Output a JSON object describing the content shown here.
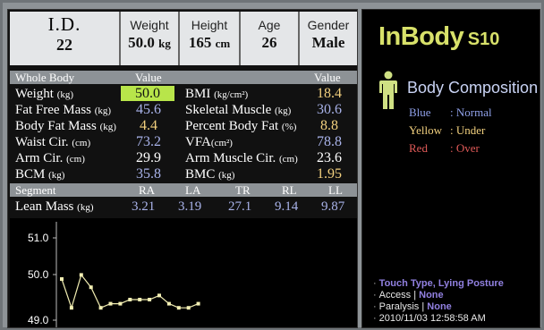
{
  "header": {
    "id_label": "I.D.",
    "id_value": "22",
    "weight_label": "Weight",
    "weight_value": "50.0",
    "weight_unit": "kg",
    "height_label": "Height",
    "height_value": "165",
    "height_unit": "cm",
    "age_label": "Age",
    "age_value": "26",
    "gender_label": "Gender",
    "gender_value": "Male"
  },
  "band": {
    "whole_body": "Whole Body",
    "value_1": "Value",
    "value_2": "Value",
    "segment": "Segment",
    "ra": "RA",
    "la": "LA",
    "tr": "TR",
    "rl": "RL",
    "ll": "LL"
  },
  "metrics": [
    {
      "label": "Weight",
      "unit": "(kg)",
      "value": "50.0",
      "right_label": "BMI",
      "right_unit": "(kg/cm²)",
      "right_value": "18.4"
    },
    {
      "label": "Fat Free Mass",
      "unit": "(kg)",
      "value": "45.6",
      "right_label": "Skeletal Muscle",
      "right_unit": "(kg)",
      "right_value": "30.6"
    },
    {
      "label": "Body Fat Mass",
      "unit": "(kg)",
      "value": "4.4",
      "right_label": "Percent Body Fat",
      "right_unit": "(%)",
      "right_value": "8.8"
    },
    {
      "label": "Waist Cir.",
      "unit": "(cm)",
      "value": "73.2",
      "right_label": "VFA",
      "right_unit": "(cm²)",
      "right_value": "78.8"
    },
    {
      "label": "Arm Cir.",
      "unit": "(cm)",
      "value": "29.9",
      "right_label": "Arm Muscle Cir.",
      "right_unit": "(cm)",
      "right_value": "23.6"
    },
    {
      "label": "BCM",
      "unit": "(kg)",
      "value": "35.8",
      "right_label": "BMC",
      "right_unit": "(kg)",
      "right_value": "1.95"
    }
  ],
  "lean_mass": {
    "label": "Lean Mass",
    "unit": "(kg)",
    "ra": "3.21",
    "la": "3.19",
    "tr": "27.1",
    "rl": "9.14",
    "ll": "9.87"
  },
  "chart_data": {
    "type": "line",
    "yticks": [
      "51.0",
      "50.0",
      "49.0"
    ],
    "ylim": [
      49.0,
      51.0
    ],
    "series": [
      {
        "values": [
          50.0,
          49.3,
          50.1,
          49.8,
          49.3,
          49.4,
          49.4,
          49.5,
          49.5,
          49.5,
          49.6,
          49.4,
          49.3,
          49.3,
          49.4
        ]
      }
    ],
    "grid": false
  },
  "brand": {
    "logo_main": "InBody",
    "logo_model": "S10"
  },
  "panel": {
    "title": "Body Composition",
    "legend": [
      {
        "name": "Blue",
        "sep": ":",
        "meaning": "Normal",
        "color": "#8fa0e8"
      },
      {
        "name": "Yellow",
        "sep": ":",
        "meaning": "Under",
        "color": "#f2d07e"
      },
      {
        "name": "Red",
        "sep": ":",
        "meaning": "Over",
        "color": "#e05a58"
      }
    ]
  },
  "status": {
    "posture": "Touch Type, Lying Posture",
    "access_label": "Access",
    "access_value": "None",
    "paralysis_label": "Paralysis",
    "paralysis_value": "None",
    "datetime": "2010/11/03 12:58:58 AM",
    "divider": "|"
  },
  "colors": {
    "normal": "#a9b3ea",
    "under": "#f2d07e",
    "highlight": "#b8e54a",
    "logo": "#d8e16a"
  }
}
